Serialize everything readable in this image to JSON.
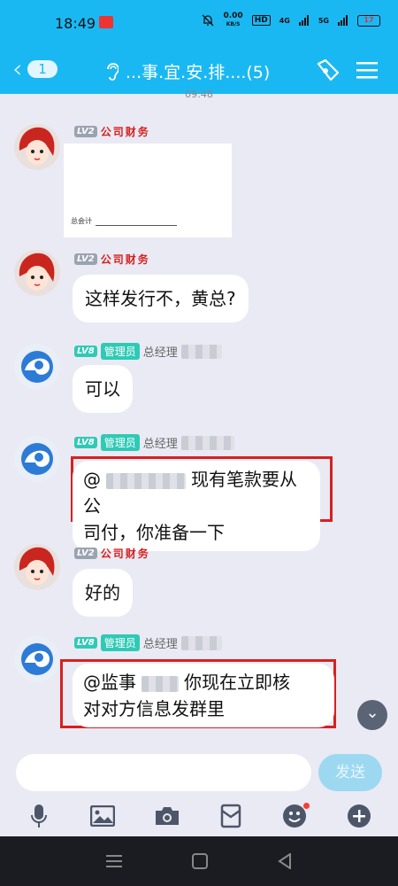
{
  "status_bar": {
    "time": "18:49",
    "speed_value": "0.00",
    "speed_unit": "KB/S",
    "hd": "HD",
    "net1": "4G",
    "net2": "5G",
    "battery": "17"
  },
  "header": {
    "unread_count": "1",
    "title": "...事.宜.安.排....(5)",
    "icons": [
      "back-chevron",
      "ear-icon",
      "group-call-icon",
      "menu-icon"
    ]
  },
  "timestamp": "09:48",
  "messages": [
    {
      "avatar": "red-hair-girl",
      "level": "LV2",
      "nickname": "公司财务",
      "type": "image",
      "image_caption": "总会计"
    },
    {
      "avatar": "red-hair-girl",
      "level": "LV2",
      "nickname": "公司财务",
      "text": "这样发行不，黄总?"
    },
    {
      "avatar": "blue-swirl",
      "level": "LV8",
      "role": "管理员",
      "nickname": "总经理",
      "text": "可以"
    },
    {
      "avatar": "blue-swirl",
      "level": "LV8",
      "role": "管理员",
      "nickname": "总经理",
      "text_line1_prefix": "@",
      "text_line1_suffix": "现有笔款要从公",
      "text_line2": "司付，你准备一下"
    },
    {
      "avatar": "red-hair-girl",
      "level": "LV2",
      "nickname": "公司财务",
      "text": "好的"
    },
    {
      "avatar": "blue-swirl",
      "level": "LV8",
      "role": "管理员",
      "nickname": "总经理",
      "text_line1_prefix": "@监事",
      "text_line1_suffix": "你现在立即核",
      "text_line2": "对对方信息发群里"
    }
  ],
  "input": {
    "placeholder": "",
    "send_label": "发送"
  },
  "toolbar_icons": [
    "mic-icon",
    "image-icon",
    "camera-icon",
    "red-packet-icon",
    "emoji-icon",
    "plus-icon"
  ],
  "colors": {
    "brand": "#1ab8f3",
    "background": "#e9eaf3",
    "highlight_red": "#d8201f",
    "admin_teal": "#2fcab6"
  }
}
